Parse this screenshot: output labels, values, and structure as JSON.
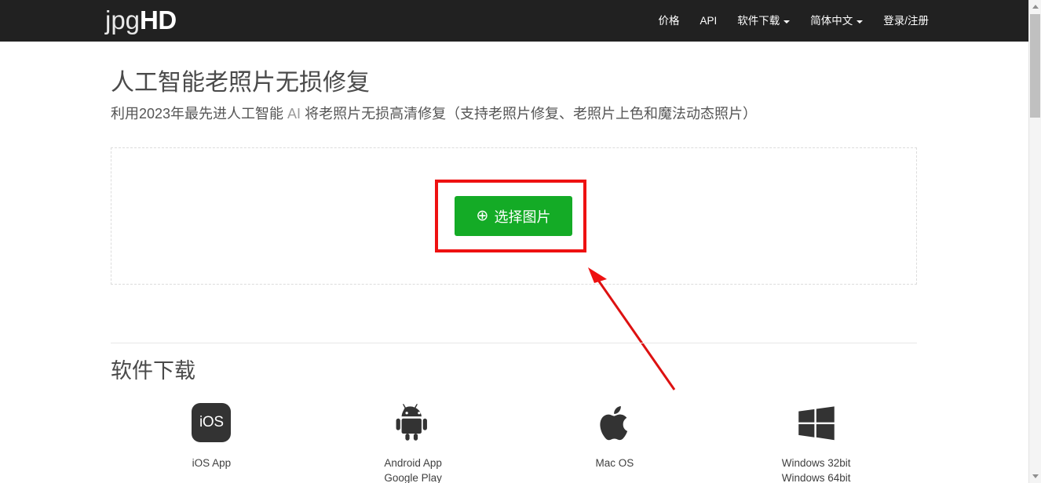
{
  "header": {
    "logo": {
      "light": "jpg",
      "bold": "HD"
    },
    "nav": [
      {
        "name": "nav-pricing",
        "label": "价格",
        "caret": false
      },
      {
        "name": "nav-api",
        "label": "API",
        "caret": false
      },
      {
        "name": "nav-download",
        "label": "软件下载",
        "caret": true
      },
      {
        "name": "nav-language",
        "label": "简体中文",
        "caret": true
      },
      {
        "name": "nav-account",
        "label": "登录/注册",
        "caret": false
      }
    ],
    "background_color": "#212121"
  },
  "hero": {
    "title": "人工智能老照片无损修复",
    "subtitle_before": "利用2023年最先进人工智能 ",
    "subtitle_ai": "AI",
    "subtitle_after": " 将老照片无损高清修复（支持老照片修复、老照片上色和魔法动态照片）"
  },
  "upload": {
    "button_icon": "⊕",
    "button_label": "选择图片",
    "button_color": "#14ab26",
    "dropzone_border_color": "#dcdcdc"
  },
  "annotations": {
    "highlight_color": "#ee1111",
    "box_target": "选择图片",
    "arrow_target": "选择图片"
  },
  "downloads": {
    "heading": "软件下载",
    "items": [
      {
        "icon": "ios-icon",
        "icon_text": "iOS",
        "labels": [
          "iOS App"
        ]
      },
      {
        "icon": "android-icon",
        "icon_text": "",
        "labels": [
          "Android App",
          "Google Play"
        ]
      },
      {
        "icon": "apple-icon",
        "icon_text": "",
        "labels": [
          "Mac OS"
        ]
      },
      {
        "icon": "windows-icon",
        "icon_text": "",
        "labels": [
          "Windows 32bit",
          "Windows 64bit"
        ]
      }
    ]
  },
  "scrollbar": {
    "up_arrow": "▲",
    "down_arrow": "▼"
  }
}
